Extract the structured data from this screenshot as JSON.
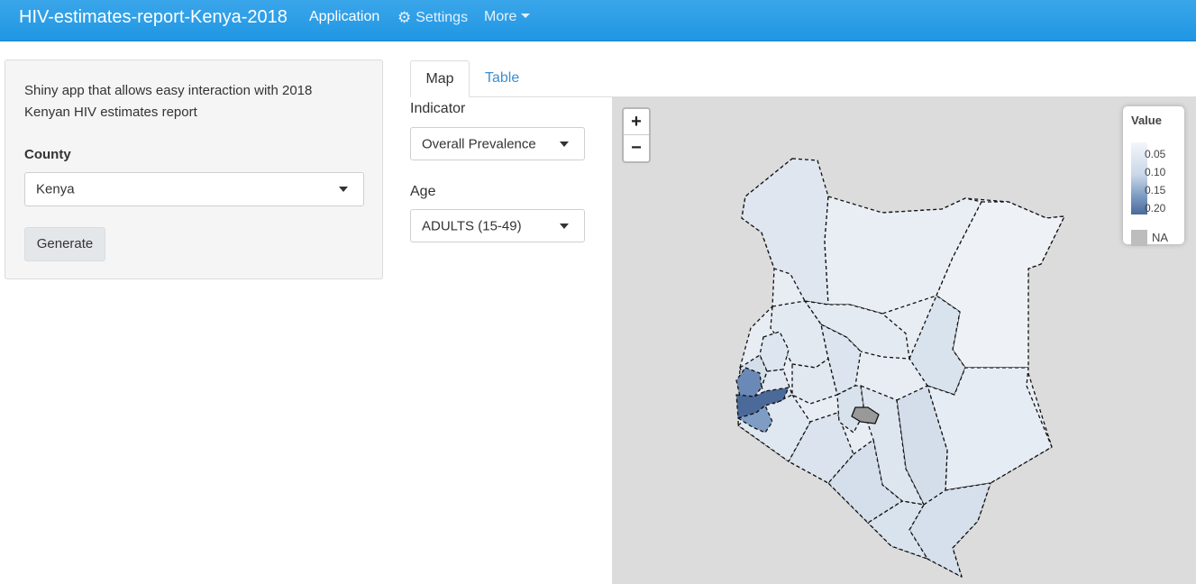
{
  "navbar": {
    "brand": "HIV-estimates-report-Kenya-2018",
    "items": [
      "Application",
      "Settings",
      "More"
    ]
  },
  "sidebar": {
    "description": "Shiny app that allows easy interaction with 2018 Kenyan HIV estimates report",
    "county_label": "County",
    "county_value": "Kenya",
    "generate_label": "Generate"
  },
  "tabs": [
    "Map",
    "Table"
  ],
  "controls": {
    "indicator_label": "Indicator",
    "indicator_value": "Overall Prevalence",
    "age_label": "Age",
    "age_value": "ADULTS (15-49)"
  },
  "map": {
    "zoom_in": "+",
    "zoom_out": "−",
    "legend": {
      "title": "Value",
      "ticks": [
        "0.05",
        "0.10",
        "0.15",
        "0.20"
      ],
      "na_label": "NA"
    },
    "colors": {
      "background": "#dcdcdc",
      "low": "#e8edf4",
      "mid": "#c5d4e6",
      "high": "#4b6a9a",
      "na": "#999999"
    }
  },
  "colors": {
    "navbar": "#2196e3",
    "link": "#3b8fd1"
  }
}
